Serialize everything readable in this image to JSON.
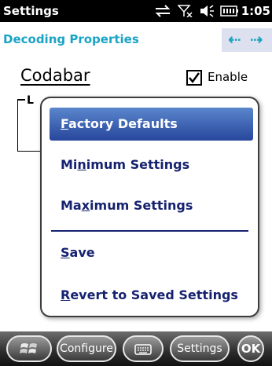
{
  "statusbar": {
    "title": "Settings",
    "time": "1:05",
    "icons": [
      "connectivity-icon",
      "no-signal-icon",
      "speaker-icon",
      "battery-icon"
    ]
  },
  "header": {
    "title": "Decoding Properties",
    "nav_back_icon": "left-arrow-icon",
    "nav_forward_icon": "right-arrow-icon"
  },
  "content": {
    "symbology": "Codabar",
    "enable_label": "Enable",
    "enable_checked": true,
    "group_label": "L"
  },
  "menu": {
    "items": [
      {
        "label": "Factory Defaults",
        "accel": "F",
        "rest": "actory Defaults",
        "selected": true
      },
      {
        "label": "Minimum Settings",
        "pre": "Mi",
        "accel": "n",
        "rest": "imum Settings"
      },
      {
        "label": "Maximum Settings",
        "pre": "Ma",
        "accel": "x",
        "rest": "imum Settings"
      },
      {
        "label": "Save",
        "accel": "S",
        "rest": "ave"
      },
      {
        "label": "Revert to Saved Settings",
        "accel": "R",
        "rest": "evert to Saved Settings"
      }
    ]
  },
  "taskbar": {
    "start_icon": "windows-start-icon",
    "configure_label": "Configure",
    "keyboard_icon": "keyboard-icon",
    "settings_label": "Settings",
    "ok_label": "OK"
  },
  "colors": {
    "accent": "#19a3c4",
    "menu_text": "#16226f",
    "selection": "#3d64b4"
  }
}
